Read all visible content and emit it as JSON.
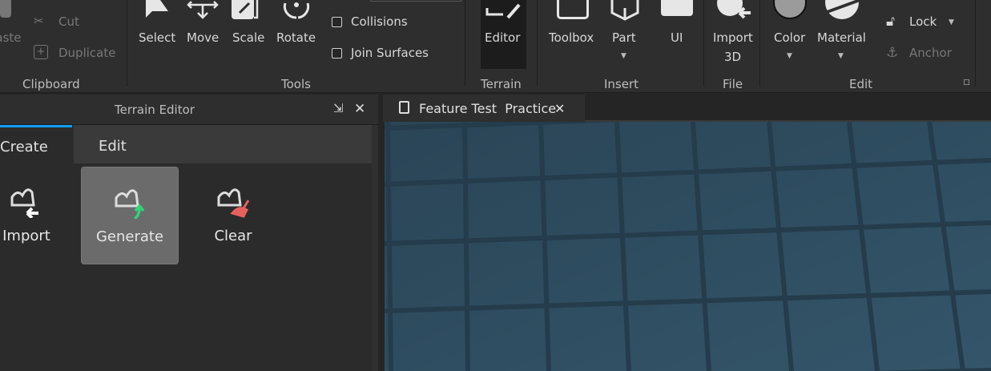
{
  "ribbon": {
    "clipboard": {
      "paste": "Paste",
      "cut": "Cut",
      "duplicate": "Duplicate",
      "group": "Clipboard"
    },
    "tools": {
      "select": "Select",
      "move": "Move",
      "scale": "Scale",
      "rotate": "Rotate",
      "collisions": "Collisions",
      "join_surfaces": "Join Surfaces",
      "group": "Tools"
    },
    "terrain": {
      "editor": "Editor",
      "group": "Terrain"
    },
    "insert": {
      "toolbox": "Toolbox",
      "part": "Part",
      "ui": "UI",
      "group": "Insert"
    },
    "file": {
      "import3d_1": "Import",
      "import3d_2": "3D",
      "group": "File"
    },
    "edit": {
      "color": "Color",
      "material": "Material",
      "lock": "Lock",
      "anchor": "Anchor",
      "group": "Edit"
    }
  },
  "terrain_panel": {
    "title": "Terrain Editor",
    "tabs": [
      "Create",
      "Edit"
    ],
    "tools": [
      "Import",
      "Generate",
      "Clear"
    ],
    "selected_tool": "Generate"
  },
  "doc_tab": {
    "title": "Feature Test  Practice"
  },
  "colors": {
    "accent": "#0e9df2",
    "generate_arrow": "#34d27a",
    "clear_brush": "#e4615e"
  }
}
